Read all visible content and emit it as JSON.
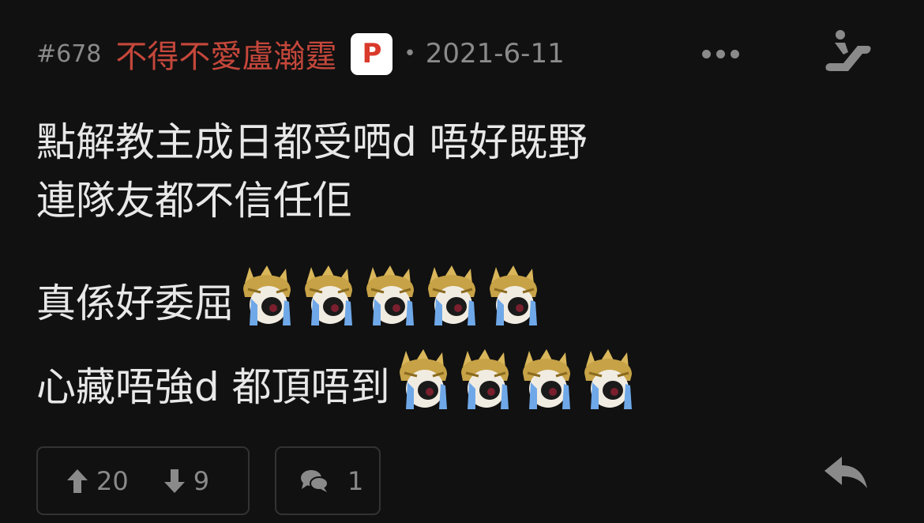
{
  "post": {
    "number": "#678",
    "username": "不得不愛盧瀚霆",
    "badge": "P",
    "separator": "•",
    "date": "2021-6-11"
  },
  "content": {
    "lines": [
      "點解教主成日都受哂d 唔好既野",
      "連隊友都不信任佢",
      "真係好委屈",
      "心藏唔強d 都頂唔到"
    ],
    "emoji_icon": "crying-character-emoji",
    "emoji_counts": [
      0,
      0,
      5,
      4
    ]
  },
  "footer": {
    "upvotes": "20",
    "downvotes": "9",
    "comments": "1"
  },
  "colors": {
    "background": "#111111",
    "username": "#c5473b",
    "muted": "#8a8a8a",
    "text": "#e8e8e8",
    "badge_text": "#d93a2b",
    "border": "#333333"
  },
  "icons": {
    "more": "more-horizontal-icon",
    "escalator": "escalator-icon",
    "upvote": "arrow-up-icon",
    "downvote": "arrow-down-icon",
    "comment": "comment-bubbles-icon",
    "reply": "reply-arrow-icon"
  }
}
